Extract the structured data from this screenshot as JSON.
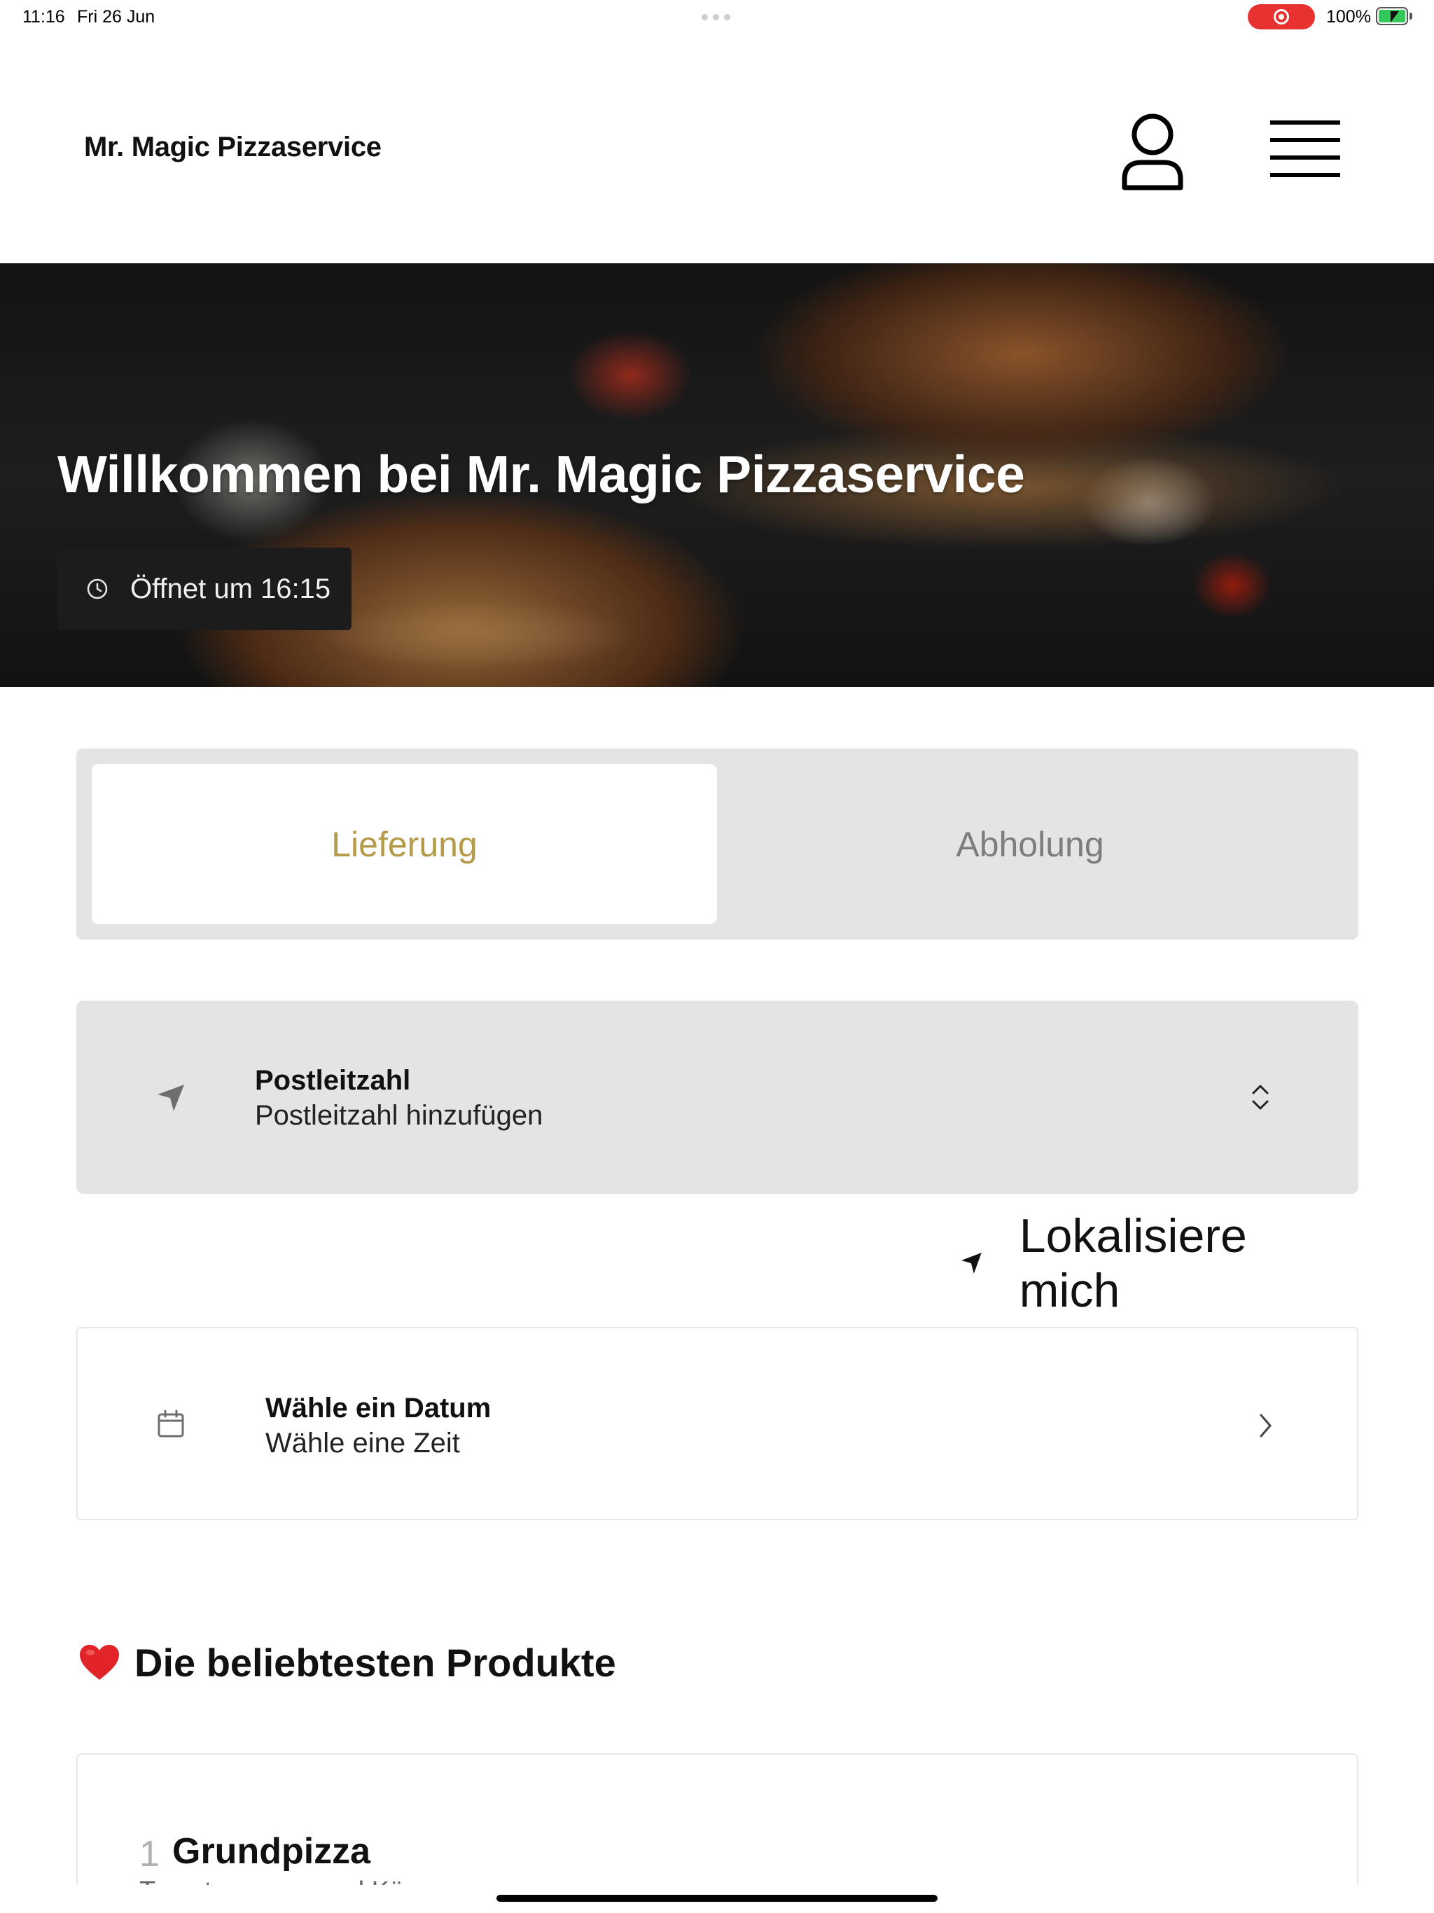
{
  "status_bar": {
    "time": "11:16",
    "date": "Fri 26 Jun",
    "battery_percent": "100%",
    "recording_color": "#e8322f",
    "battery_color": "#34c759"
  },
  "header": {
    "brand": "Mr. Magic Pizzaservice",
    "user_icon": "user-icon",
    "menu_icon": "hamburger-menu-icon"
  },
  "hero": {
    "title": "Willkommen bei Mr. Magic Pizzaservice",
    "opening": "Öffnet um 16:15",
    "clock_icon": "clock-icon"
  },
  "order_mode": {
    "options": [
      {
        "label": "Lieferung",
        "active": true
      },
      {
        "label": "Abholung",
        "active": false
      }
    ],
    "active_color": "#b59a4a",
    "inactive_color": "#7d7d7d"
  },
  "postcode": {
    "label": "Postleitzahl",
    "value": "Postleitzahl hinzufügen",
    "icon": "navigation-arrow-icon",
    "control_icon": "chevron-up-down-icon"
  },
  "locate": {
    "label": "Lokalisiere mich",
    "icon": "location-arrow-icon"
  },
  "date_picker": {
    "label": "Wähle ein Datum",
    "value": "Wähle eine Zeit",
    "icon": "calendar-icon",
    "control_icon": "chevron-right-icon"
  },
  "popular": {
    "title": "Die beliebtesten Produkte",
    "icon": "heart-icon",
    "products": [
      {
        "number": "1",
        "name": "Grundpizza",
        "description": "Tomatensauce und Käse"
      }
    ]
  }
}
